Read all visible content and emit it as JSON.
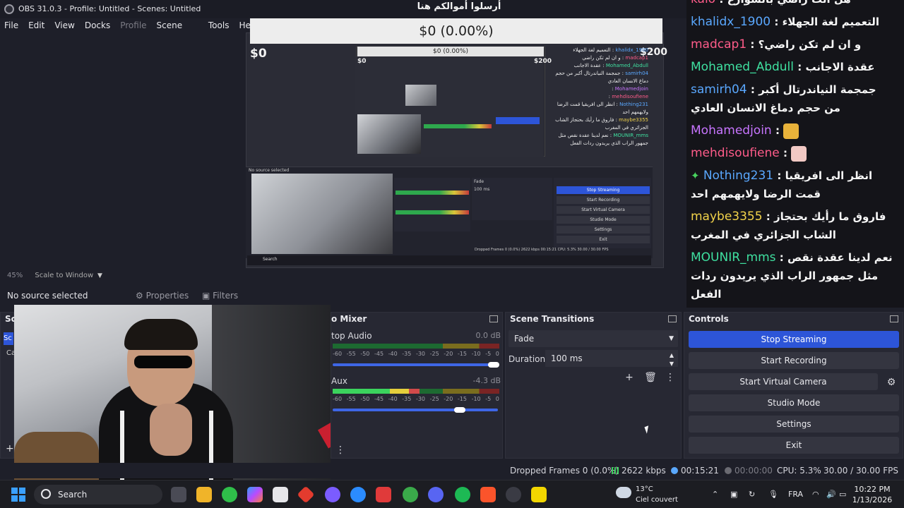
{
  "window": {
    "title": "OBS 31.0.3 - Profile: Untitled - Scenes: Untitled",
    "minimize_glyph": "—",
    "maximize_glyph": "▢",
    "close_glyph": "✕"
  },
  "menu": {
    "items": [
      "File",
      "Edit",
      "View",
      "Docks",
      "Profile",
      "Scene Collection",
      "Tools",
      "Hel"
    ]
  },
  "preview": {
    "donation_title": "أرسلوا أموالكم هنا",
    "donation_amount": "$0 (0.00%)",
    "goal_min": "$0",
    "goal_max": "$200",
    "inner_amount": "$0 (0.00%)",
    "inner_goal_min": "$0",
    "inner_goal_max": "$200",
    "inner_chat": [
      {
        "name": "khalidx_1900",
        "text": "التعميم لغة الجهلاء"
      },
      {
        "name": "madcap1",
        "text": "و ان لم تكن راضي"
      },
      {
        "name": "Mohamed_Abdull",
        "text": "عقدة الاجانب"
      },
      {
        "name": "samirh04",
        "text": "جمجمة النياندرتال أكبر من حجم دماغ الانسان العادي"
      },
      {
        "name": "Mohamedjoin",
        "text": ""
      },
      {
        "name": "mehdisoufiene",
        "text": ""
      },
      {
        "name": "Nothing231",
        "text": "انظر الى افريقيا قمت الرضا ولايهمهم احد"
      },
      {
        "name": "maybe3355",
        "text": "فاروق ما رأيك بحتجاز الشاب الجزائري في المغرب"
      },
      {
        "name": "MOUNIR_mms",
        "text": "نعم لدينا عقدة نقص مثل جمهور الراب الذي يريدون ردات الفعل"
      }
    ],
    "inner_no_source": "No source selected",
    "inner_transition": "Fade",
    "inner_duration": "100 ms",
    "inner_stop": "Stop Streaming",
    "inner_buttons": [
      "Start Recording",
      "Start Virtual Camera",
      "Studio Mode",
      "Settings",
      "Exit"
    ],
    "inner_status": "Dropped Frames 0 (0.0%)",
    "inner_kbps": "2622 kbps",
    "inner_time": "00:15:21",
    "inner_cpu": "CPU: 5.3%",
    "inner_fps": "30.00 / 30.00 FPS",
    "inner_search": "Search"
  },
  "chat": {
    "messages": [
      {
        "name": "kaio",
        "color": "#ff5c8a",
        "text": "هل انت راضي بالشوارع"
      },
      {
        "name": "khalidx_1900",
        "color": "#5aa8ff",
        "text": "التعميم لغة الجهلاء"
      },
      {
        "name": "madcap1",
        "color": "#ff5c8a",
        "text": "و ان لم تكن راضي؟"
      },
      {
        "name": "Mohamed_Abdull",
        "color": "#3fe0a0",
        "text": "عقدة الاجانب"
      },
      {
        "name": "samirh04",
        "color": "#5aa8ff",
        "text": "جمجمة النياندرتال أكبر من حجم دماغ الانسان العادي"
      },
      {
        "name": "Mohamedjoin",
        "color": "#c875ff",
        "text": ""
      },
      {
        "name": "mehdisoufiene",
        "color": "#ff5c8a",
        "text": ""
      },
      {
        "name": "Nothing231",
        "color": "#5aa8ff",
        "text": "انظر الى افريقيا قمت الرضا ولايهمهم احد"
      },
      {
        "name": "maybe3355",
        "color": "#f2d34a",
        "text": "فاروق ما رأيك بحتجاز الشاب الجزائري في المغرب"
      },
      {
        "name": "MOUNIR_mms",
        "color": "#3fe0a0",
        "text": "نعم لدينا عقدة نقص مثل جمهور الراب الذي يريدون ردات الفعل"
      }
    ],
    "separator": ":"
  },
  "zoom": {
    "level": "45%",
    "mode": "Scale to Window"
  },
  "source_bar": {
    "no_source": "No source selected",
    "properties": "Properties",
    "filters": "Filters"
  },
  "scenes_dock": {
    "title_fragment": "Sc",
    "item1": "Sc",
    "item2": "Ca"
  },
  "mixer": {
    "title": "o Mixer",
    "channels": [
      {
        "name": "top Audio",
        "db": "0.0 dB",
        "level": 0.0,
        "volume": 1.0
      },
      {
        "name": "Aux",
        "db": "-4.3 dB",
        "level": 0.52,
        "volume": 0.78
      }
    ],
    "ticks": [
      "-60",
      "-55",
      "-50",
      "-45",
      "-40",
      "-35",
      "-30",
      "-25",
      "-20",
      "-15",
      "-10",
      "-5",
      "0"
    ]
  },
  "transitions": {
    "title": "Scene Transitions",
    "selected": "Fade",
    "duration_label": "Duration",
    "duration_value": "100 ms"
  },
  "controls": {
    "title": "Controls",
    "stop_streaming": "Stop Streaming",
    "start_recording": "Start Recording",
    "start_virtual_camera": "Start Virtual Camera",
    "studio_mode": "Studio Mode",
    "settings": "Settings",
    "exit": "Exit"
  },
  "status": {
    "dropped": "Dropped Frames 0 (0.0%)",
    "kbps": "2622 kbps",
    "stream_time": "00:15:21",
    "record_time": "00:00:00",
    "cpu": "CPU: 5.3%",
    "fps": "30.00 / 30.00 FPS"
  },
  "taskbar": {
    "search": "Search",
    "temperature": "13°C",
    "weather_desc": "Ciel couvert",
    "lang": "FRA",
    "time": "10:22 PM",
    "date": "1/13/2026"
  },
  "colors": {
    "accent": "#2d55d8",
    "meter_green": "#3bd35d",
    "meter_yellow": "#e5cf3c",
    "meter_red": "#d14a4a"
  }
}
